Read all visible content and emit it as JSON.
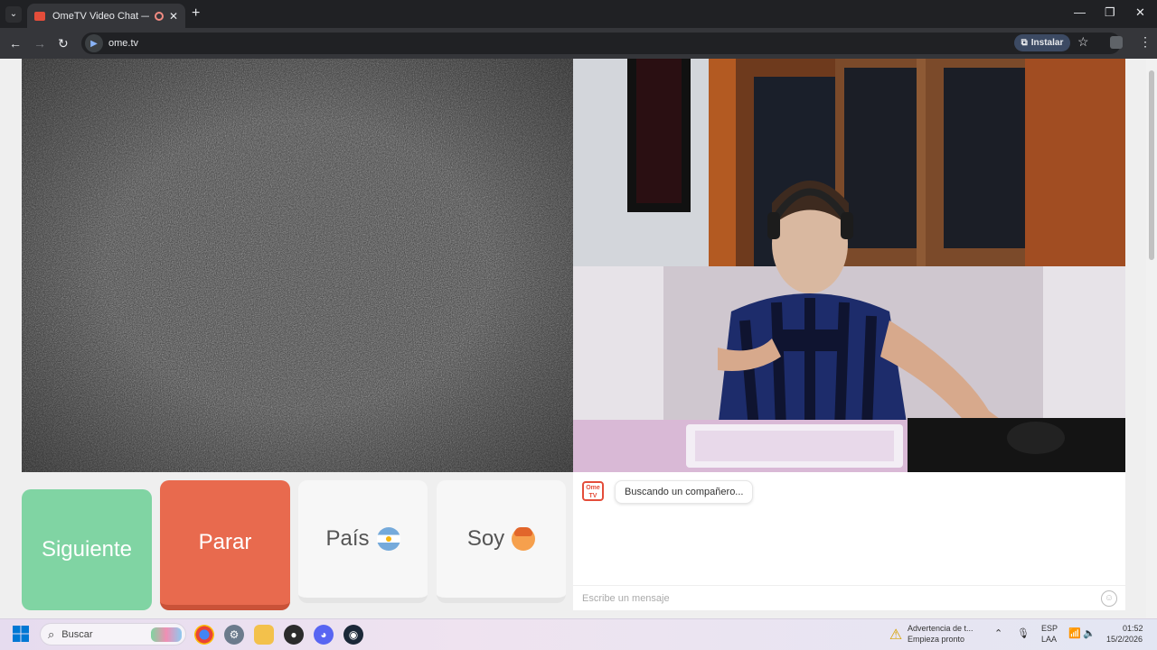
{
  "browser": {
    "tab_title": "OmeTV Video Chat — Ome",
    "tab_close": "✕",
    "new_tab": "+",
    "url": "ome.tv",
    "install_label": "Instalar",
    "window_controls": [
      "—",
      "❐",
      "✕"
    ]
  },
  "app": {
    "buttons": {
      "next": "Siguiente",
      "stop": "Parar",
      "country": "País",
      "gender": "Soy"
    },
    "chat": {
      "logo_text": "Ome TV",
      "status_message": "Buscando un compañero...",
      "input_placeholder": "Escribe un mensaje"
    }
  },
  "taskbar": {
    "search_label": "Buscar",
    "notification_title": "Advertencia de t...",
    "notification_sub": "Empieza pronto",
    "language": "ESP",
    "layout": "LAA",
    "time": "01:52",
    "date": "15/2/2026"
  },
  "colors": {
    "next_button": "#80d4a3",
    "stop_button": "#e86a4e",
    "brand_red": "#e44d3a"
  },
  "icons": [
    "tab-list-icon",
    "back-icon",
    "forward-icon",
    "reload-icon",
    "install-icon",
    "bookmark-star-icon",
    "extension-icon",
    "menu-icon",
    "flag-argentina-icon",
    "face-emoji-icon",
    "emoji-icon",
    "windows-start-icon",
    "search-icon",
    "chrome-icon",
    "settings-icon",
    "files-icon",
    "discord-icon",
    "steam-icon",
    "warning-icon",
    "mic-icon",
    "wifi-icon",
    "volume-icon"
  ]
}
